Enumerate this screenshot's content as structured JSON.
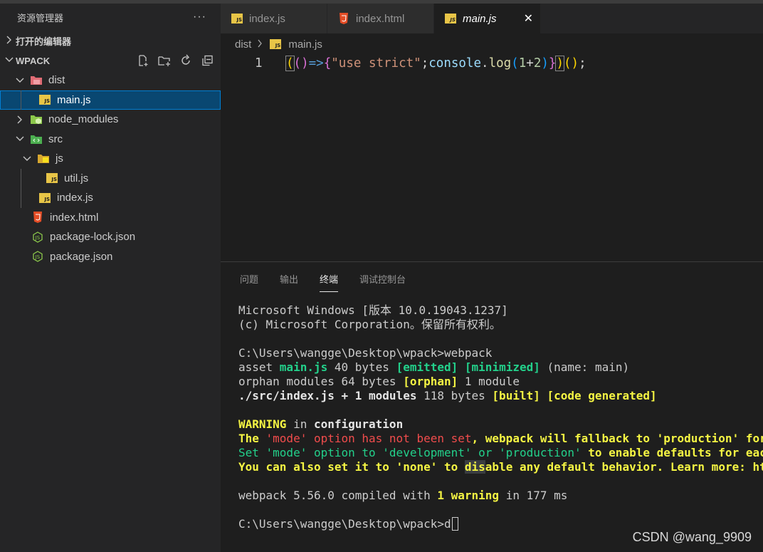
{
  "sidebar": {
    "title": "资源管理器",
    "more": "···",
    "open_editors": "打开的编辑器",
    "project": "WPACK",
    "tree": {
      "dist": "dist",
      "main_js": "main.js",
      "node_modules": "node_modules",
      "src": "src",
      "js": "js",
      "util_js": "util.js",
      "index_js": "index.js",
      "index_html": "index.html",
      "package_lock": "package-lock.json",
      "package_json": "package.json"
    }
  },
  "tabs": [
    {
      "label": "index.js",
      "icon": "js"
    },
    {
      "label": "index.html",
      "icon": "html5"
    },
    {
      "label": "main.js",
      "icon": "js",
      "active": true
    }
  ],
  "tab_close": "✕",
  "breadcrumb": {
    "folder": "dist",
    "file": "main.js"
  },
  "editor": {
    "line_number": "1",
    "code": "(()=>{\"use strict\";console.log(1+2)})();"
  },
  "panel": {
    "tabs": [
      "问题",
      "输出",
      "终端",
      "调试控制台"
    ],
    "active_tab": "终端"
  },
  "terminal": {
    "l1": "Microsoft Windows [版本 10.0.19043.1237]",
    "l2": "(c) Microsoft Corporation。保留所有权利。",
    "l3": "C:\\Users\\wangge\\Desktop\\wpack>webpack",
    "asset_word": "asset ",
    "asset_name": "main.js",
    "asset_size": " 40 bytes ",
    "emitted": "[emitted]",
    "minimized": "[minimized]",
    "asset_rest": " (name: main)",
    "orphan_a": "orphan modules 64 bytes ",
    "orphan_tag": "[orphan]",
    "orphan_b": " 1 module",
    "src_a": "./src/index.js + 1 modules",
    "src_b": " 118 bytes ",
    "built": "[built]",
    "code_gen": "[code generated]",
    "warning": "WARNING",
    "warn_in": " in ",
    "warn_cfg": "configuration",
    "w1_a": "The ",
    "w1_b": "'mode' option has not been set",
    "w1_c": ", webpack will fallback to 'production' for this",
    "w2_a": "Set 'mode' option to 'development' or 'production'",
    "w2_b": " to enable defaults for each env",
    "w3_a": "You can also set it to 'none' to ",
    "w3_sel": "dis",
    "w3_b": "able any default behavior. Learn more: https:/",
    "c_a": "webpack 5.56.0 compiled with ",
    "c_warn": "1 warning",
    "c_b": " in 177 ms",
    "prompt": "C:\\Users\\wangge\\Desktop\\wpack>d"
  },
  "watermark": "CSDN @wang_9909",
  "colors": {
    "accent": "#007fd4",
    "selection": "#094771",
    "js_icon": "#e8c547",
    "html_icon": "#e44d26",
    "npm_icon": "#8cc84b"
  }
}
